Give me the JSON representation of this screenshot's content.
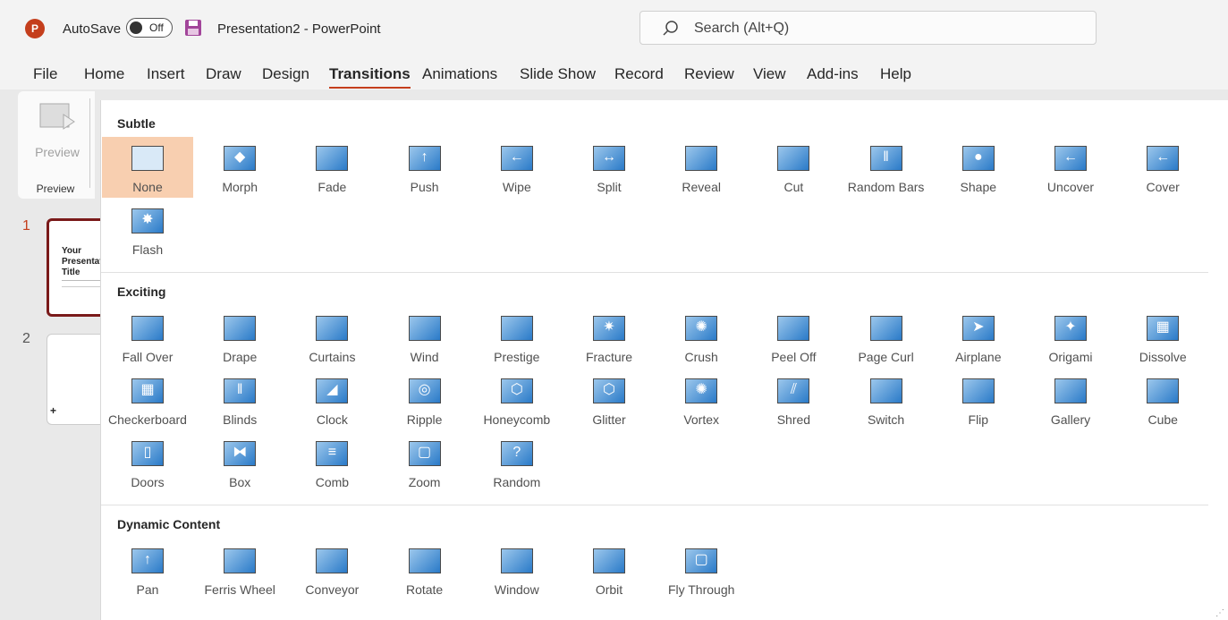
{
  "titlebar": {
    "app_logo": "P",
    "autosave_label": "AutoSave",
    "autosave_state": "Off",
    "save_icon": "save-icon",
    "document_title": "Presentation2  -  PowerPoint",
    "search_placeholder": "Search (Alt+Q)"
  },
  "menu": {
    "active": "Transitions",
    "tabs": [
      "File",
      "Home",
      "Insert",
      "Draw",
      "Design",
      "Transitions",
      "Animations",
      "Slide Show",
      "Record",
      "Review",
      "View",
      "Add-ins",
      "Help"
    ]
  },
  "ribbon": {
    "preview_button": "Preview",
    "preview_group": "Preview"
  },
  "slides": [
    {
      "number": "1",
      "title": "Your Presentation Title",
      "active": true
    },
    {
      "number": "2",
      "title": "",
      "active": false
    }
  ],
  "gallery": {
    "selected": "None",
    "sections": [
      {
        "title": "Subtle",
        "items": [
          {
            "name": "None",
            "glyph": ""
          },
          {
            "name": "Morph",
            "glyph": "◆"
          },
          {
            "name": "Fade",
            "glyph": ""
          },
          {
            "name": "Push",
            "glyph": "↑"
          },
          {
            "name": "Wipe",
            "glyph": "←"
          },
          {
            "name": "Split",
            "glyph": "↔"
          },
          {
            "name": "Reveal",
            "glyph": ""
          },
          {
            "name": "Cut",
            "glyph": ""
          },
          {
            "name": "Random Bars",
            "glyph": "‖"
          },
          {
            "name": "Shape",
            "glyph": "●"
          },
          {
            "name": "Uncover",
            "glyph": "←"
          },
          {
            "name": "Cover",
            "glyph": "←"
          },
          {
            "name": "Flash",
            "glyph": "✸"
          }
        ]
      },
      {
        "title": "Exciting",
        "items": [
          {
            "name": "Fall Over",
            "glyph": ""
          },
          {
            "name": "Drape",
            "glyph": ""
          },
          {
            "name": "Curtains",
            "glyph": ""
          },
          {
            "name": "Wind",
            "glyph": ""
          },
          {
            "name": "Prestige",
            "glyph": ""
          },
          {
            "name": "Fracture",
            "glyph": "✷"
          },
          {
            "name": "Crush",
            "glyph": "✺"
          },
          {
            "name": "Peel Off",
            "glyph": ""
          },
          {
            "name": "Page Curl",
            "glyph": ""
          },
          {
            "name": "Airplane",
            "glyph": "➤"
          },
          {
            "name": "Origami",
            "glyph": "✦"
          },
          {
            "name": "Dissolve",
            "glyph": "▦"
          },
          {
            "name": "Checkerboard",
            "glyph": "▦"
          },
          {
            "name": "Blinds",
            "glyph": "‖"
          },
          {
            "name": "Clock",
            "glyph": "◢"
          },
          {
            "name": "Ripple",
            "glyph": "◎"
          },
          {
            "name": "Honeycomb",
            "glyph": "⬡"
          },
          {
            "name": "Glitter",
            "glyph": "⬡"
          },
          {
            "name": "Vortex",
            "glyph": "✺"
          },
          {
            "name": "Shred",
            "glyph": "⫽"
          },
          {
            "name": "Switch",
            "glyph": ""
          },
          {
            "name": "Flip",
            "glyph": ""
          },
          {
            "name": "Gallery",
            "glyph": ""
          },
          {
            "name": "Cube",
            "glyph": ""
          },
          {
            "name": "Doors",
            "glyph": "▯"
          },
          {
            "name": "Box",
            "glyph": "⧓"
          },
          {
            "name": "Comb",
            "glyph": "≡"
          },
          {
            "name": "Zoom",
            "glyph": "▢"
          },
          {
            "name": "Random",
            "glyph": "?"
          }
        ]
      },
      {
        "title": "Dynamic Content",
        "items": [
          {
            "name": "Pan",
            "glyph": "↑"
          },
          {
            "name": "Ferris Wheel",
            "glyph": ""
          },
          {
            "name": "Conveyor",
            "glyph": ""
          },
          {
            "name": "Rotate",
            "glyph": ""
          },
          {
            "name": "Window",
            "glyph": ""
          },
          {
            "name": "Orbit",
            "glyph": ""
          },
          {
            "name": "Fly Through",
            "glyph": "▢"
          }
        ]
      }
    ]
  },
  "colors": {
    "accent": "#c43e1c",
    "selected_bg": "#f8cfb0",
    "icon_blue": "#2a7ac8"
  }
}
